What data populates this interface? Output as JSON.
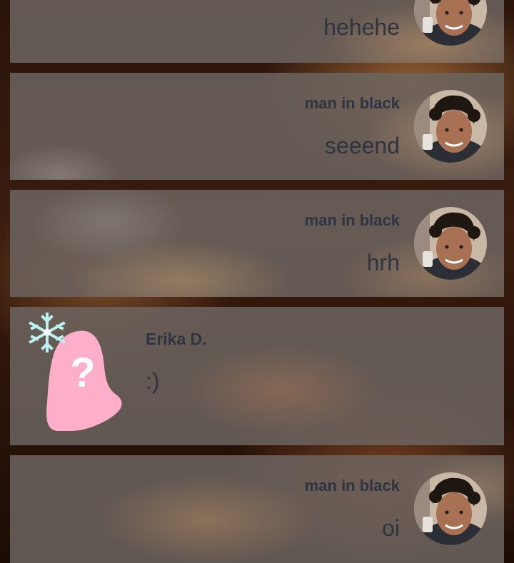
{
  "messages": [
    {
      "sender": "",
      "text": "hehehe",
      "align": "right"
    },
    {
      "sender": "man in black",
      "text": "seeend",
      "align": "right"
    },
    {
      "sender": "man in black",
      "text": "hrh",
      "align": "right"
    },
    {
      "sender": "Erika D.",
      "text": ":)",
      "align": "left"
    },
    {
      "sender": "man in black",
      "text": "oi",
      "align": "right"
    }
  ],
  "colors": {
    "card_bg": "#6c6460",
    "text": "#2f3443",
    "unknown_avatar": "#ffafc9",
    "snowflake": "#bdf0f0"
  },
  "icons": {
    "user_photo": "user-photo-avatar",
    "unknown_user": "unknown-user-avatar",
    "snowflake": "snowflake-icon"
  }
}
